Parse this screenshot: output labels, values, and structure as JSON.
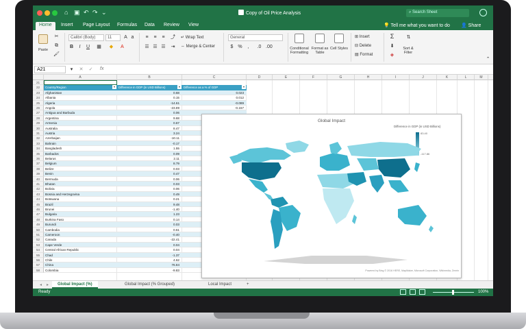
{
  "window": {
    "title": "Copy of Oil Price Analysis",
    "search_placeholder": "Search Sheet"
  },
  "ribbon_tabs": [
    "Home",
    "Insert",
    "Page Layout",
    "Formulas",
    "Data",
    "Review",
    "View"
  ],
  "tell_me": "Tell me what you want to do",
  "share": "Share",
  "ribbon": {
    "paste": "Paste",
    "font_name": "Calibri (Body)",
    "font_size": "11",
    "bold": "B",
    "italic": "I",
    "underline": "U",
    "wrap_text": "Wrap Text",
    "merge_center": "Merge & Center",
    "number_format": "General",
    "conditional_formatting": "Conditional Formatting",
    "format_as_table": "Format as Table",
    "cell_styles": "Cell Styles",
    "insert": "Insert",
    "delete": "Delete",
    "format": "Format",
    "sort_filter": "Sort & Filter"
  },
  "formula_bar": {
    "name_box": "A21",
    "fx": "fx"
  },
  "columns": [
    "A",
    "B",
    "C",
    "D",
    "E",
    "F",
    "G",
    "H",
    "I",
    "J",
    "K",
    "L",
    "M",
    "N",
    "O"
  ],
  "table": {
    "headers": [
      "Country/Region",
      "Difference in GDP (in USD Billions)",
      "Difference as a % of GDP"
    ],
    "rows": [
      [
        "Afghanistan",
        "0.68",
        "0.023"
      ],
      [
        "Albania",
        "0.15",
        "0.012"
      ],
      [
        "Algeria",
        "-14.61",
        "-0.089"
      ],
      [
        "Angola",
        "-23.89",
        "-0.157"
      ],
      [
        "Antigua and Barbuda",
        "0.06",
        ""
      ],
      [
        "Argentina",
        "9.68",
        ""
      ],
      [
        "Armenia",
        "0.67",
        ""
      ],
      [
        "Australia",
        "8.47",
        ""
      ],
      [
        "Austria",
        "3.24",
        ""
      ],
      [
        "Azerbaijan",
        "-10.11",
        ""
      ],
      [
        "Bahrain",
        "-0.17",
        ""
      ],
      [
        "Bangladesh",
        "1.55",
        ""
      ],
      [
        "Barbados",
        "0.09",
        ""
      ],
      [
        "Belarus",
        "2.11",
        ""
      ],
      [
        "Belgium",
        "8.79",
        ""
      ],
      [
        "Belize",
        "0.03",
        ""
      ],
      [
        "Benin",
        "0.47",
        ""
      ],
      [
        "Bermuda",
        "0.06",
        ""
      ],
      [
        "Bhutan",
        "0.03",
        ""
      ],
      [
        "Bolivia",
        "0.06",
        ""
      ],
      [
        "Bosnia and Herzegovina",
        "0.49",
        ""
      ],
      [
        "Botswana",
        "0.21",
        ""
      ],
      [
        "Brazil",
        "9.48",
        ""
      ],
      [
        "Brunei",
        "-1.40",
        ""
      ],
      [
        "Bulgaria",
        "1.23",
        ""
      ],
      [
        "Burkina Faso",
        "0.14",
        ""
      ],
      [
        "Burundi",
        "0.03",
        ""
      ],
      [
        "Cambodia",
        "0.61",
        ""
      ],
      [
        "Cameroon",
        "-0.40",
        ""
      ],
      [
        "Canada",
        "-22.41",
        ""
      ],
      [
        "Cape Verde",
        "0.04",
        ""
      ],
      [
        "Central African Republic",
        "0.04",
        ""
      ],
      [
        "Chad",
        "-1.37",
        ""
      ],
      [
        "Chile",
        "4.62",
        ""
      ],
      [
        "China",
        "76.84",
        ""
      ],
      [
        "Colombia",
        "-9.83",
        "-0.026"
      ]
    ],
    "row_start": 21
  },
  "chart": {
    "title": "Global Impact",
    "legend_title": "Difference in GDP (in USD Billions)",
    "legend_max": "83.40",
    "legend_min": "-117.86",
    "credit": "Powered by Bing\n© 2016 HERE, MapMaker, Microsoft Corporation, Wikimedia, Zenrin"
  },
  "sheet_tabs": [
    "Global Impact (%)",
    "Global Impact (% Grouped)",
    "Local Impact"
  ],
  "status": {
    "ready": "Ready",
    "zoom": "100%"
  }
}
